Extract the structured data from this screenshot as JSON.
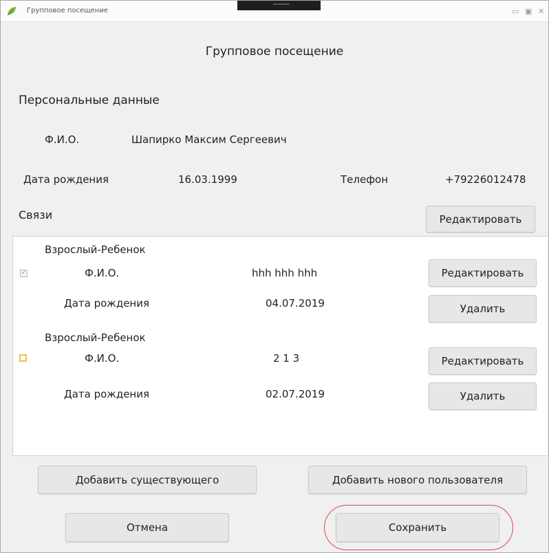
{
  "window": {
    "title": "Групповое посещение",
    "controls": [
      "▭",
      "▣",
      "✕"
    ]
  },
  "header": {
    "title": "Групповое посещение"
  },
  "personal": {
    "section_title": "Персональные данные",
    "fio_label": "Ф.И.О.",
    "fio_value": "Шапирко Максим Сергеевич",
    "birth_label": "Дата рождения",
    "birth_value": "16.03.1999",
    "phone_label": "Телефон",
    "phone_value": "+79226012478"
  },
  "links": {
    "section_title": "Связи",
    "edit_label": "Редактировать",
    "items": [
      {
        "relation": "Взрослый-Ребенок",
        "checked": true,
        "fio_label": "Ф.И.О.",
        "fio_value": "hhh hhh hhh",
        "birth_label": "Дата рождения",
        "birth_value": "04.07.2019",
        "edit_label": "Редактировать",
        "delete_label": "Удалить"
      },
      {
        "relation": "Взрослый-Ребенок",
        "checked": false,
        "fio_label": "Ф.И.О.",
        "fio_value": "2 1 3",
        "birth_label": "Дата рождения",
        "birth_value": "02.07.2019",
        "edit_label": "Редактировать",
        "delete_label": "Удалить"
      }
    ]
  },
  "actions": {
    "add_existing": "Добавить существующего",
    "add_new": "Добавить нового пользователя",
    "cancel": "Отмена",
    "save": "Сохранить"
  },
  "colors": {
    "accent_highlight": "#d84a4a",
    "unchecked_box": "#e8c44c"
  }
}
